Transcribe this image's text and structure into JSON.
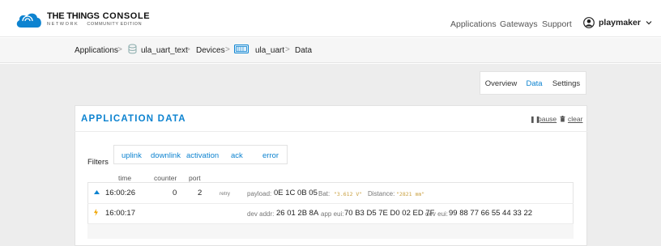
{
  "header": {
    "brand": "THE THINGS",
    "brand_network": "NETWORK",
    "console": "CONSOLE",
    "edition": "COMMUNITY EDITION",
    "nav": [
      "Applications",
      "Gateways",
      "Support"
    ],
    "username": "playmaker"
  },
  "breadcrumb": {
    "items": [
      "Applications",
      "ula_uart_text",
      "Devices",
      "ula_uart",
      "Data"
    ],
    "separator": ">"
  },
  "tabs": [
    {
      "label": "Overview",
      "active": false
    },
    {
      "label": "Data",
      "active": true
    },
    {
      "label": "Settings",
      "active": false
    }
  ],
  "card": {
    "title": "APPLICATION DATA",
    "pause_label": "pause",
    "clear_label": "clear"
  },
  "filters": {
    "label": "Filters",
    "options": [
      "uplink",
      "downlink",
      "activation",
      "ack",
      "error"
    ]
  },
  "columns": [
    "time",
    "counter",
    "port"
  ],
  "rows": [
    {
      "type": "uplink",
      "time": "16:00:26",
      "counter": "0",
      "port": "2",
      "retry": "retry",
      "payload_label": "payload:",
      "payload": "0E 1C 0B 05",
      "bat_label": "Bat:",
      "bat_value": "\"3.612 V\"",
      "dist_label": "Distance:",
      "dist_value": "\"2821 mm\""
    },
    {
      "type": "activation",
      "time": "16:00:17",
      "devaddr_label": "dev addr:",
      "devaddr": "26 01 2B 8A",
      "appeui_label": "app eui:",
      "appeui": "70 B3 D5 7E D0 02 ED 7F",
      "deveui_label": "dev eui:",
      "deveui": "99 88 77 66 55 44 33 22"
    }
  ],
  "colors": {
    "accent": "#0d83d0",
    "activation": "#f0a500",
    "value_mono": "#c9a040"
  },
  "icons": [
    "cloud-logo-icon",
    "user-avatar-icon",
    "chevron-down-icon",
    "application-icon",
    "device-icon",
    "pause-icon",
    "trash-icon",
    "uplink-arrow-icon",
    "activation-bolt-icon"
  ]
}
